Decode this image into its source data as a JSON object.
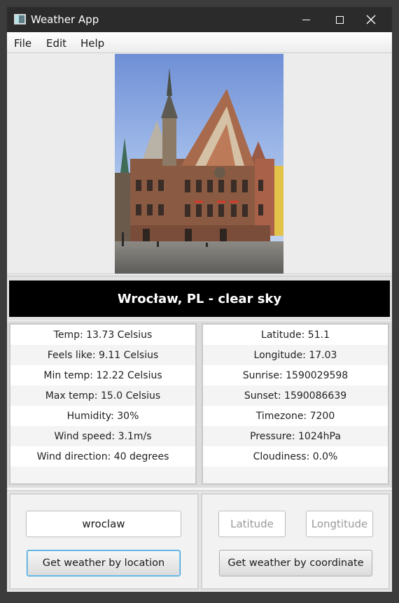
{
  "window": {
    "title": "Weather App"
  },
  "menu": [
    "File",
    "Edit",
    "Help"
  ],
  "banner": {
    "text": "Wrocław, PL - clear sky"
  },
  "weather": [
    "Temp: 13.73 Celsius",
    "Feels like: 9.11 Celsius",
    "Min temp: 12.22 Celsius",
    "Max temp: 15.0 Celsius",
    "Humidity: 30%",
    "Wind speed: 3.1m/s",
    "Wind direction: 40 degrees"
  ],
  "location": [
    "Latitude: 51.1",
    "Longitude: 17.03",
    "Sunrise: 1590029598",
    "Sunset: 1590086639",
    "Timezone: 7200",
    "Pressure: 1024hPa",
    "Cloudiness: 0.0%"
  ],
  "controls": {
    "city_value": "wroclaw",
    "location_button": "Get weather by location",
    "latitude_placeholder": "Latitude",
    "longitude_placeholder": "Longtitude",
    "coordinate_button": "Get weather by coordinate"
  },
  "colors": {
    "banner_bg": "#000000",
    "focus_accent": "#3c9fd8"
  }
}
